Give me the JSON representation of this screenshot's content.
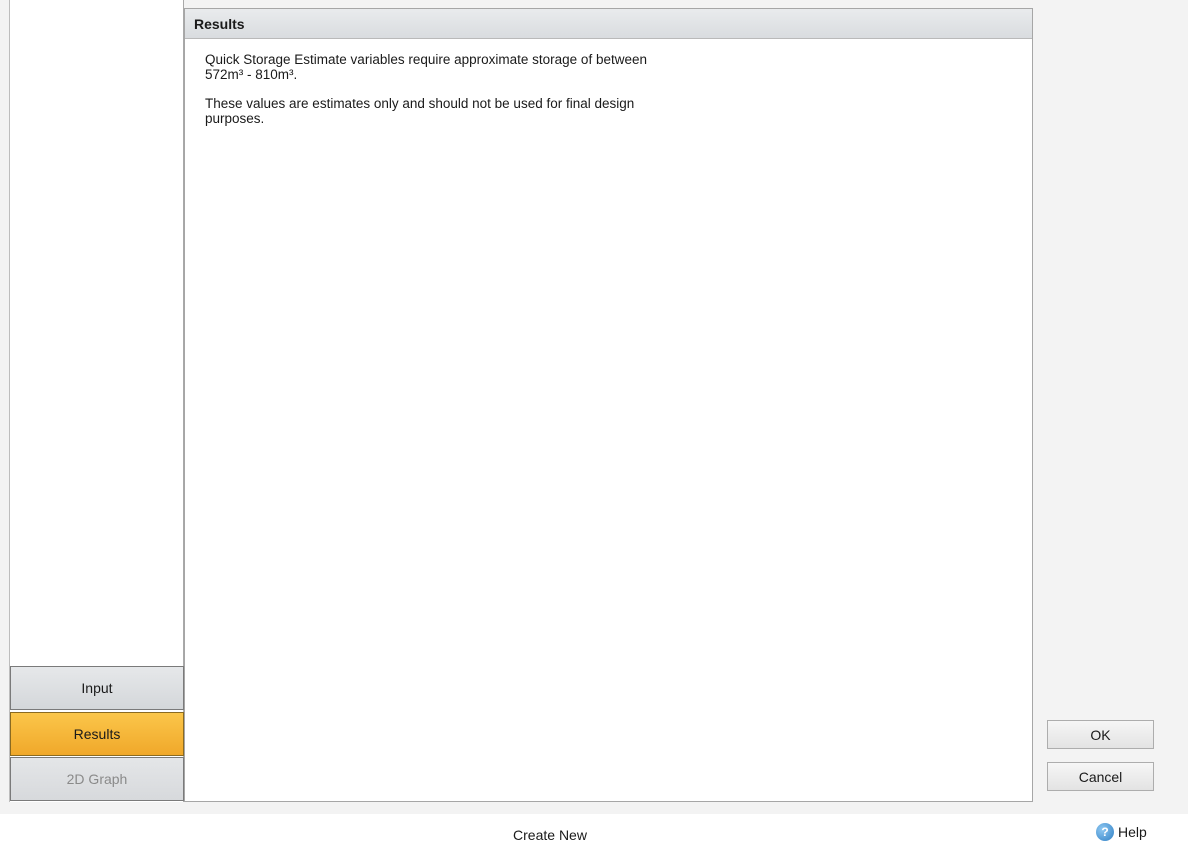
{
  "panel": {
    "title": "Results",
    "line1": "Quick Storage Estimate variables require approximate storage of between 572m³ - 810m³.",
    "line2": "These values are estimates only and should not be used for final design purposes."
  },
  "nav": {
    "input_label": "Input",
    "results_label": "Results",
    "graph_label": "2D Graph"
  },
  "buttons": {
    "ok_label": "OK",
    "cancel_label": "Cancel"
  },
  "footer": {
    "create_new_label": "Create New",
    "help_label": "Help",
    "help_icon_name": "help-icon"
  },
  "colors": {
    "active_tab": "#f0a82a"
  }
}
